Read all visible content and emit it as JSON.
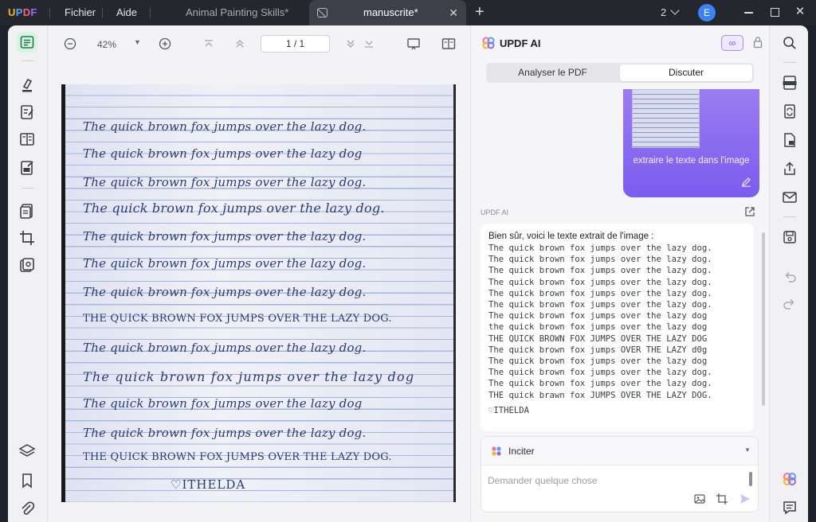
{
  "app": {
    "logo": "UPDF"
  },
  "menu": {
    "file": "Fichier",
    "help": "Aide"
  },
  "tabs": [
    {
      "label": "Animal Painting Skills*",
      "active": false
    },
    {
      "label": "manuscrite*",
      "active": true
    }
  ],
  "titlebar": {
    "window_count": "2",
    "avatar_letter": "E"
  },
  "viewer": {
    "zoom": "42%",
    "page_indicator": "1 / 1"
  },
  "document": {
    "lines": [
      "The quick brown fox jumps over the lazy dog.",
      "The quick brown fox jumps over the lazy dog",
      "The quick brown fox jumps over the lazy dog.",
      "The quick brown fox jumps over the lazy dog.",
      "The quick brown fox jumps over the lazy dog.",
      "The quick brown fox jumps over the lazy dog.",
      "The quick brown fox jumps over the lazy dog.",
      "THE QUICK BROWN FOX JUMPS OVER THE LAZY DOG.",
      "The quick brown fox jumps over the lazy dog.",
      "The quick brown fox jumps over the lazy dog",
      "The quick brown fox jumps over the lazy dog",
      "The quick brown fox jumps over the lazy dog.",
      "THE QUICK BROWN FOX JUMPS OVER THE LAZY DOG."
    ],
    "signature": "♡ITHELDA"
  },
  "ai_panel": {
    "title": "UPDF AI",
    "infinity": "∞",
    "mode_tabs": {
      "analyze": "Analyser le PDF",
      "chat": "Discuter"
    },
    "user_message": "extraire le texte dans l'image",
    "ai_label": "UPDF AI",
    "response_intro": "Bien sûr, voici le texte extrait de l'image :",
    "response_lines": [
      "The quick brown fox jumps over the lazy dog.",
      "The quick brown fox jumps over the lazy dog.",
      "The quick brown fox jumps over the lazy dog.",
      "The quick brown fox jumps over the lazy dog.",
      "The quick brown fox jumps over the lazy dog.",
      "The quick brown fox jumps over the lazy dog.",
      "The quick brown fox jumps over the lazy dog",
      "the quick brown fox jumps over the lazy dog",
      "THE QUICK BROWN FOX JUMPS OVER THE LAZY DOG",
      "The quick brown fox jumps OVER THE LAZY d0g",
      "The quick brown fox jumps over the lazy dog",
      "The quick brown fox jumps over the lazy dog.",
      "The quick brown fox jumps over the lazy dog.",
      "THE quick brawn fox JUMPS OVER THE LAZY DOG."
    ],
    "response_signature": "♡ITHELDA",
    "prompt_label": "Inciter",
    "input_placeholder": "Demander quelque chose"
  }
}
